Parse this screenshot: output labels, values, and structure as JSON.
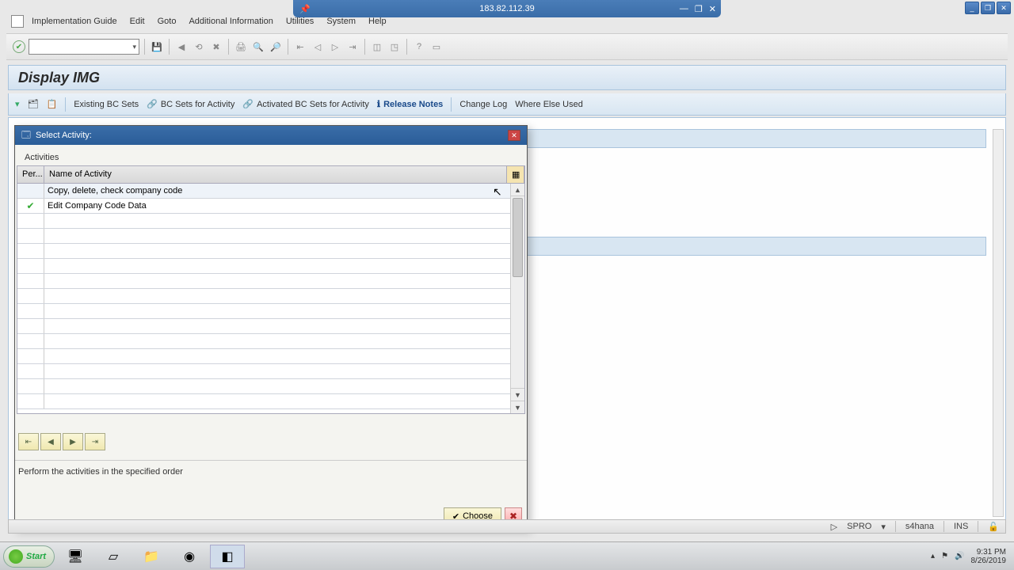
{
  "remote": {
    "ip": "183.82.112.39"
  },
  "menu": {
    "items": [
      "Implementation Guide",
      "Edit",
      "Goto",
      "Additional Information",
      "Utilities",
      "System",
      "Help"
    ]
  },
  "page": {
    "title": "Display IMG"
  },
  "apptoolbar": {
    "existing_bc": "Existing BC Sets",
    "bc_activity": "BC Sets for Activity",
    "activated_bc": "Activated BC Sets for Activity",
    "release_notes": "Release Notes",
    "change_log": "Change Log",
    "where_else": "Where Else Used"
  },
  "dialog": {
    "title": "Select Activity:",
    "group": "Activities",
    "col_per": "Per...",
    "col_name": "Name of Activity",
    "rows": [
      {
        "per": "",
        "name": "Copy, delete, check company code"
      },
      {
        "per": "check",
        "name": "Edit Company Code Data"
      }
    ],
    "hint": "Perform the activities in the specified order",
    "choose": "Choose"
  },
  "status": {
    "tcode": "SPRO",
    "system": "s4hana",
    "mode": "INS"
  },
  "taskbar": {
    "start": "Start",
    "time": "9:31 PM",
    "date": "8/26/2019"
  }
}
